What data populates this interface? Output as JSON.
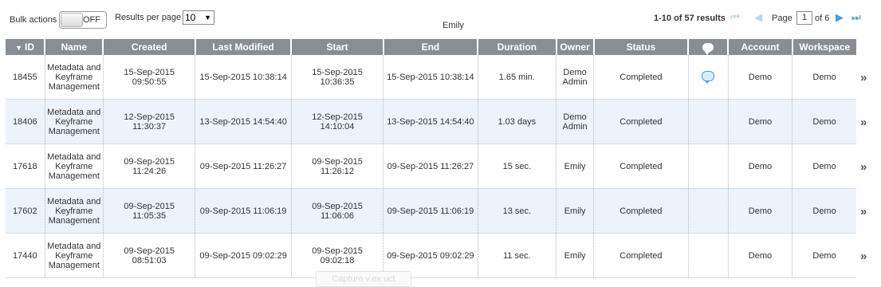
{
  "toolbar": {
    "bulk_label": "Bulk actions",
    "toggle_state": "OFF",
    "rpp_label": "Results per page",
    "rpp_value": "10",
    "rpp_arrow": "▼",
    "user": "Emily",
    "results_text": "1-10 of 57 results",
    "page_label": "Page",
    "page_value": "1",
    "of_label": "of 6"
  },
  "icons": {
    "first": "first-page-icon",
    "prev": "previous-page-icon",
    "next": "next-page-icon",
    "last": "last-page-icon",
    "first_glyph": "⏮",
    "prev_glyph": "◀",
    "next_glyph": "▶",
    "last_glyph": "⏭",
    "chevron_glyph": "»",
    "sort_glyph": "▼"
  },
  "colors": {
    "header_bg": "#888e94",
    "accent": "#4a9be5",
    "row_alt": "#edf3fb"
  },
  "columns": [
    "ID",
    "Name",
    "Created",
    "Last Modified",
    "Start",
    "End",
    "Duration",
    "Owner",
    "Status",
    "",
    "Account",
    "Workspace"
  ],
  "rows": [
    {
      "id": "18455",
      "name": "Metadata and Keyframe Management",
      "created_date": "15-Sep-2015",
      "created_time": "09:50:55",
      "modified": "15-Sep-2015 10:38:14",
      "start_date": "15-Sep-2015",
      "start_time": "10:36:35",
      "end": "15-Sep-2015 10:38:14",
      "duration": "1.65 min.",
      "owner": "Demo Admin",
      "status": "Completed",
      "has_comment": true,
      "account": "Demo",
      "workspace": "Demo"
    },
    {
      "id": "18406",
      "name": "Metadata and Keyframe Management",
      "created_date": "12-Sep-2015",
      "created_time": "11:30:37",
      "modified": "13-Sep-2015 14:54:40",
      "start_date": "12-Sep-2015",
      "start_time": "14:10:04",
      "end": "13-Sep-2015 14:54:40",
      "duration": "1.03 days",
      "owner": "Demo Admin",
      "status": "Completed",
      "has_comment": false,
      "account": "Demo",
      "workspace": "Demo"
    },
    {
      "id": "17618",
      "name": "Metadata and Keyframe Management",
      "created_date": "09-Sep-2015",
      "created_time": "11:24:26",
      "modified": "09-Sep-2015 11:26:27",
      "start_date": "09-Sep-2015",
      "start_time": "11:26:12",
      "end": "09-Sep-2015 11:26:27",
      "duration": "15 sec.",
      "owner": "Emily",
      "status": "Completed",
      "has_comment": false,
      "account": "Demo",
      "workspace": "Demo"
    },
    {
      "id": "17602",
      "name": "Metadata and Keyframe Management",
      "created_date": "09-Sep-2015",
      "created_time": "11:05:35",
      "modified": "09-Sep-2015 11:06:19",
      "start_date": "09-Sep-2015",
      "start_time": "11:06:06",
      "end": "09-Sep-2015 11:06:19",
      "duration": "13 sec.",
      "owner": "Emily",
      "status": "Completed",
      "has_comment": false,
      "account": "Demo",
      "workspace": "Demo"
    },
    {
      "id": "17440",
      "name": "Metadata and Keyframe Management",
      "created_date": "09-Sep-2015",
      "created_time": "08:51:03",
      "modified": "09-Sep-2015 09:02:29",
      "start_date": "09-Sep-2015",
      "start_time": "09:02:18",
      "end": "09-Sep-2015 09:02:29",
      "duration": "11 sec.",
      "owner": "Emily",
      "status": "Completed",
      "has_comment": false,
      "account": "Demo",
      "workspace": "Demo"
    }
  ],
  "overlay": {
    "capture_label": "Capture v.ex.uct"
  }
}
